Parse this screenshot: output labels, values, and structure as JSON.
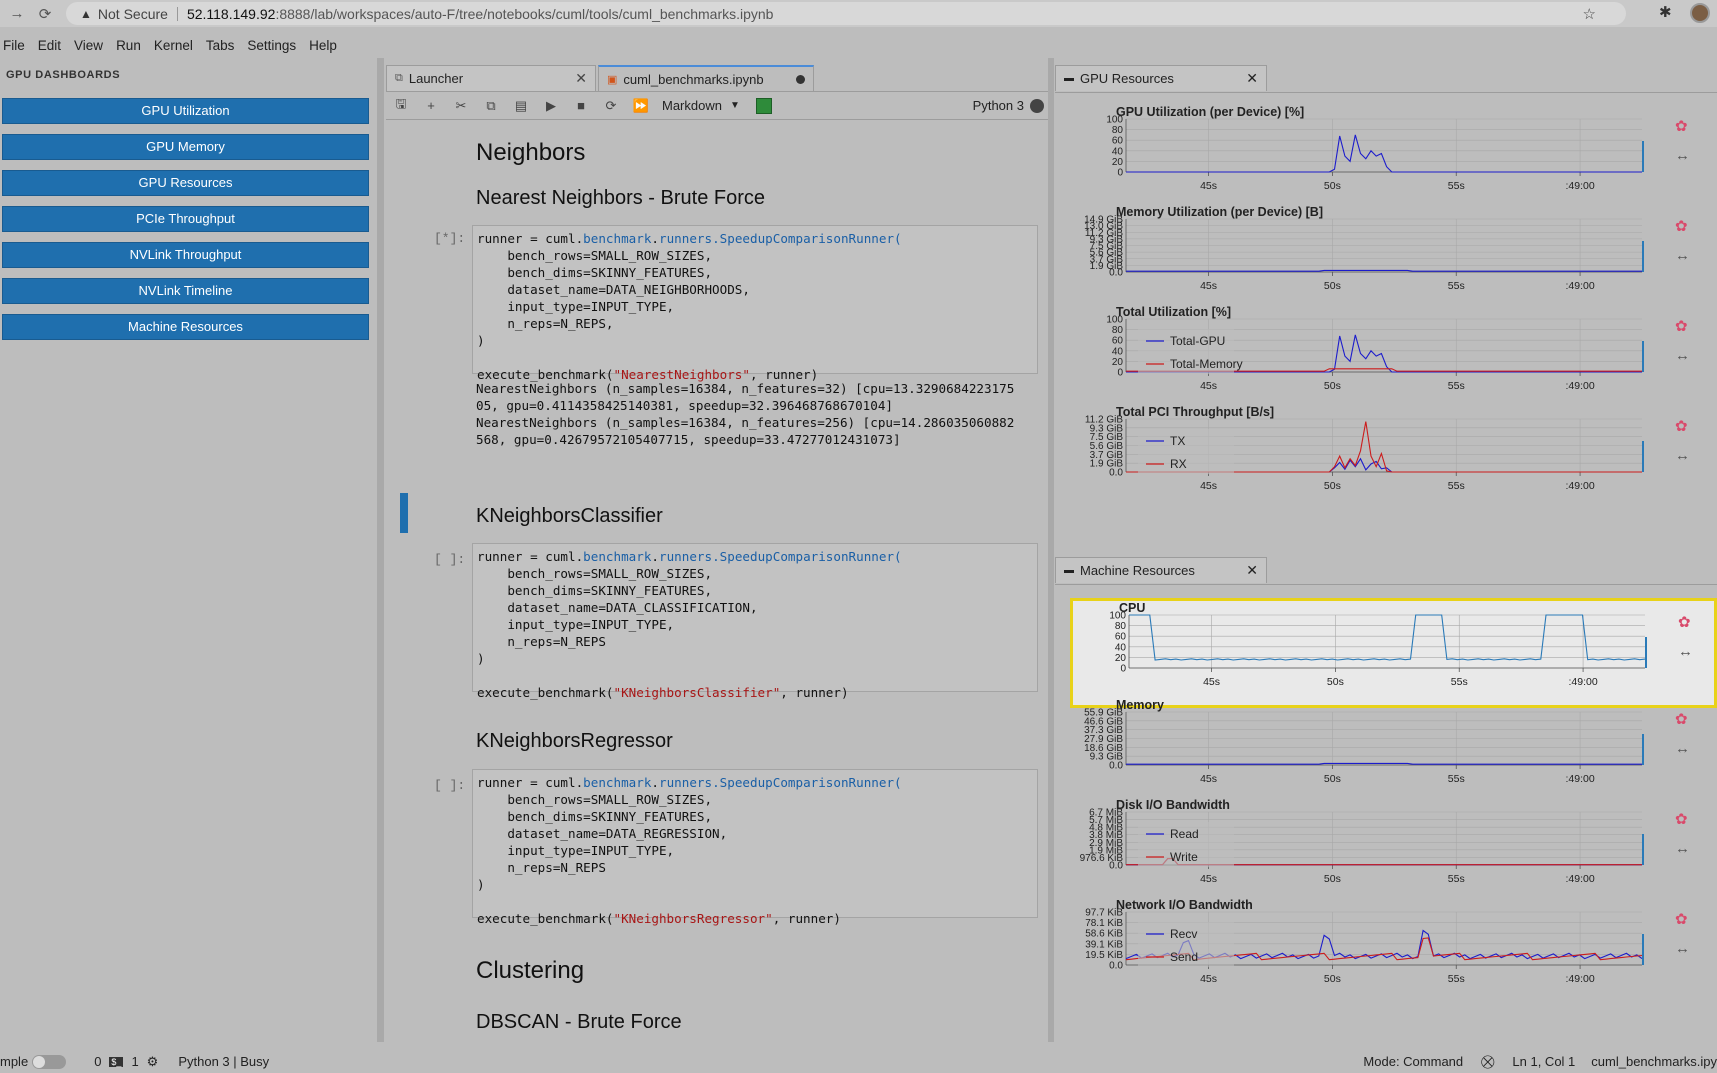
{
  "browser": {
    "security": "Not Secure",
    "url_host": "52.118.149.92",
    "url_rest": ":8888/lab/workspaces/auto-F/tree/notebooks/cuml/tools/cuml_benchmarks.ipynb"
  },
  "menu": [
    "File",
    "Edit",
    "View",
    "Run",
    "Kernel",
    "Tabs",
    "Settings",
    "Help"
  ],
  "sidebar": {
    "header": "GPU DASHBOARDS",
    "buttons": [
      "GPU Utilization",
      "GPU Memory",
      "GPU Resources",
      "PCIe Throughput",
      "NVLink Throughput",
      "NVLink Timeline",
      "Machine Resources"
    ]
  },
  "tabs": {
    "launcher": "Launcher",
    "notebook": "cuml_benchmarks.ipynb"
  },
  "toolbar": {
    "cell_type": "Markdown",
    "kernel": "Python 3"
  },
  "notebook": {
    "h_neighbors": "Neighbors",
    "h_nn": "Nearest Neighbors - Brute Force",
    "h_knc": "KNeighborsClassifier",
    "h_knr": "KNeighborsRegressor",
    "h_clustering": "Clustering",
    "h_dbscan": "DBSCAN - Brute Force",
    "prompt_running": "[*]:",
    "prompt_empty": "[ ]:",
    "cells": [
      {
        "runner_pre": "runner = cuml.",
        "runner_mod": "benchmark",
        "runner_dot": ".",
        "runner_mod2": "runners",
        "runner_cls": ".SpeedupComparisonRunner(",
        "lines": [
          "    bench_rows=SMALL_ROW_SIZES,",
          "    bench_dims=SKINNY_FEATURES,",
          "    dataset_name=DATA_NEIGHBORHOODS,",
          "    input_type=INPUT_TYPE,",
          "    n_reps=N_REPS,",
          ")"
        ],
        "exec_pre": "execute_benchmark(",
        "exec_str": "\"NearestNeighbors\"",
        "exec_post": ", runner)"
      },
      {
        "runner_pre": "runner = cuml.",
        "runner_mod": "benchmark",
        "runner_dot": ".",
        "runner_mod2": "runners",
        "runner_cls": ".SpeedupComparisonRunner(",
        "lines": [
          "    bench_rows=SMALL_ROW_SIZES,",
          "    bench_dims=SKINNY_FEATURES,",
          "    dataset_name=DATA_CLASSIFICATION,",
          "    input_type=INPUT_TYPE,",
          "    n_reps=N_REPS",
          ")"
        ],
        "exec_pre": "execute_benchmark(",
        "exec_str": "\"KNeighborsClassifier\"",
        "exec_post": ", runner)"
      },
      {
        "runner_pre": "runner = cuml.",
        "runner_mod": "benchmark",
        "runner_dot": ".",
        "runner_mod2": "runners",
        "runner_cls": ".SpeedupComparisonRunner(",
        "lines": [
          "    bench_rows=SMALL_ROW_SIZES,",
          "    bench_dims=SKINNY_FEATURES,",
          "    dataset_name=DATA_REGRESSION,",
          "    input_type=INPUT_TYPE,",
          "    n_reps=N_REPS",
          ")"
        ],
        "exec_pre": "execute_benchmark(",
        "exec_str": "\"KNeighborsRegressor\"",
        "exec_post": ", runner)"
      }
    ],
    "output": [
      "NearestNeighbors (n_samples=16384, n_features=32) [cpu=13.3290684223175",
      "05, gpu=0.4114358425140381, speedup=32.396468768670104]",
      "NearestNeighbors (n_samples=16384, n_features=256) [cpu=14.286035060882",
      "568, gpu=0.42679572105407715, speedup=33.47277012431073]"
    ]
  },
  "gpu_panel": {
    "title": "GPU Resources",
    "charts": [
      {
        "title": "GPU Utilization (per Device) [%]",
        "yticks": [
          "100",
          "80",
          "60",
          "40",
          "20",
          "0"
        ],
        "legend": [],
        "series": [
          {
            "color": "#1c1ccc",
            "shape": "gpu"
          }
        ]
      },
      {
        "title": "Memory Utilization (per Device) [B]",
        "yticks": [
          "14.9 GiB",
          "13.0 GiB",
          "11.2 GiB",
          "9.3 GiB",
          "7.5 GiB",
          "5.6 GiB",
          "3.7 GiB",
          "1.9 GiB",
          "0.0"
        ],
        "legend": [],
        "series": [
          {
            "color": "#1c1ccc",
            "shape": "flat"
          }
        ]
      },
      {
        "title": "Total Utilization [%]",
        "yticks": [
          "100",
          "80",
          "60",
          "40",
          "20",
          "0"
        ],
        "legend": [
          "Total-GPU",
          "Total-Memory"
        ],
        "series": [
          {
            "color": "#1c1ccc",
            "shape": "gpu"
          },
          {
            "color": "#cc1c1c",
            "shape": "low"
          }
        ]
      },
      {
        "title": "Total PCI Throughput [B/s]",
        "yticks": [
          "11.2 GiB",
          "9.3 GiB",
          "7.5 GiB",
          "5.6 GiB",
          "3.7 GiB",
          "1.9 GiB",
          "0.0"
        ],
        "legend": [
          "TX",
          "RX"
        ],
        "series": [
          {
            "color": "#1c1ccc",
            "shape": "pci-tx"
          },
          {
            "color": "#cc1c1c",
            "shape": "pci-rx"
          }
        ]
      }
    ],
    "xticks": [
      "45s",
      "50s",
      "55s",
      ":49:00"
    ]
  },
  "machine_panel": {
    "title": "Machine Resources",
    "charts": [
      {
        "title": "CPU",
        "yticks": [
          "100",
          "80",
          "60",
          "40",
          "20",
          "0"
        ],
        "legend": [],
        "series": [
          {
            "color": "#2a7ab8",
            "shape": "cpu"
          }
        ]
      },
      {
        "title": "Memory",
        "yticks": [
          "55.9 GiB",
          "46.6 GiB",
          "37.3 GiB",
          "27.9 GiB",
          "18.6 GiB",
          "9.3 GiB",
          "0.0"
        ],
        "legend": [],
        "series": [
          {
            "color": "#1c1ccc",
            "shape": "flat"
          }
        ]
      },
      {
        "title": "Disk I/O Bandwidth",
        "yticks": [
          "6.7 MiB",
          "5.7 MiB",
          "4.8 MiB",
          "3.8 MiB",
          "2.9 MiB",
          "1.9 MiB",
          "976.6 KiB",
          "0.0"
        ],
        "legend": [
          "Read",
          "Write"
        ],
        "series": [
          {
            "color": "#1c1ccc",
            "shape": "zero"
          },
          {
            "color": "#cc1c1c",
            "shape": "zero"
          }
        ]
      },
      {
        "title": "Network I/O Bandwidth",
        "yticks": [
          "97.7 KiB",
          "78.1 KiB",
          "58.6 KiB",
          "39.1 KiB",
          "19.5 KiB",
          "0.0"
        ],
        "legend": [
          "Recv",
          "Send"
        ],
        "series": [
          {
            "color": "#1c1ccc",
            "shape": "net"
          },
          {
            "color": "#cc1c1c",
            "shape": "net2"
          }
        ]
      }
    ],
    "xticks": [
      "45s",
      "50s",
      "55s",
      ":49:00"
    ]
  },
  "status": {
    "mode_label": "mple",
    "terminals": "0",
    "kernels": "1",
    "kernel_status": "Python 3 | Busy",
    "mode": "Mode: Command",
    "position": "Ln 1, Col 1",
    "file": "cuml_benchmarks.ipy"
  }
}
